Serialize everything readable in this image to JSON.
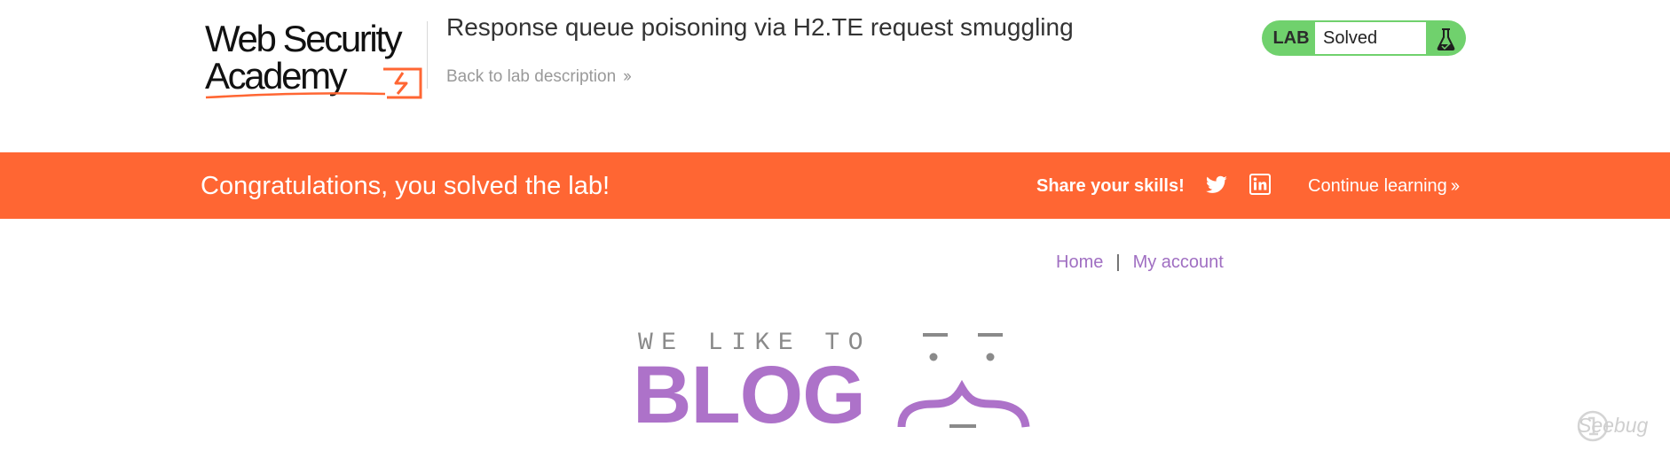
{
  "header": {
    "logo": {
      "line1": "Web Security",
      "line2": "Academy"
    },
    "lab_title": "Response queue poisoning via H2.TE request smuggling",
    "back_link": "Back to lab description",
    "lab_status": {
      "tag": "LAB",
      "state": "Solved",
      "icon": "flask-icon"
    }
  },
  "banner": {
    "message": "Congratulations, you solved the lab!",
    "share_label": "Share your skills!",
    "share_icons": [
      "twitter-icon",
      "linkedin-icon"
    ],
    "continue_link": "Continue learning",
    "color": "#ff6633"
  },
  "nav": {
    "items": [
      "Home",
      "My account"
    ],
    "separator": "|",
    "link_color": "#a06fc2"
  },
  "hero": {
    "tagline": "WE LIKE TO",
    "word": "BLOG",
    "accent": "#ad72c9"
  },
  "watermark": "Seebug",
  "colors": {
    "lab_solved": "#70d16d",
    "title_text": "#333333",
    "muted_text": "#999999"
  }
}
